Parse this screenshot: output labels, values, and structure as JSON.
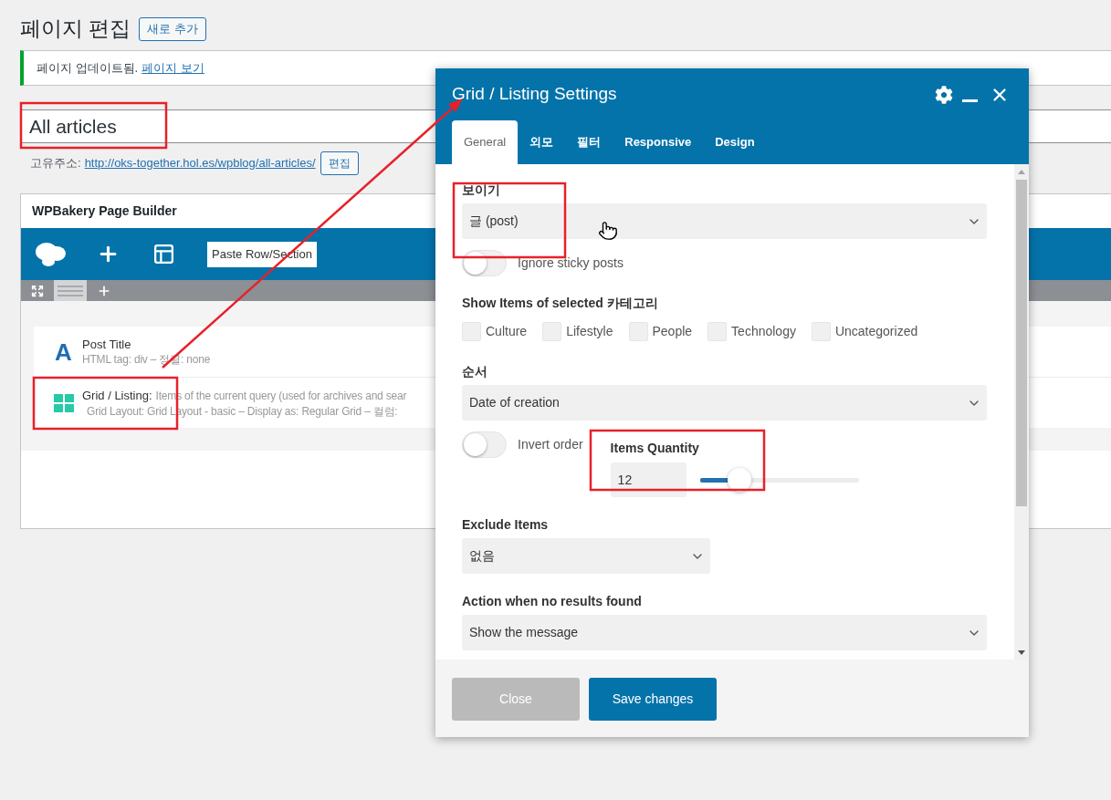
{
  "page": {
    "heading": "페이지 편집",
    "add_new_button": "새로 추가"
  },
  "notice": {
    "message": "페이지 업데이트됨.",
    "link": "페이지 보기"
  },
  "title_field": {
    "value": "All articles"
  },
  "permalink": {
    "label": "고유주소:",
    "url": "http://oks-together.hol.es/wpblog/all-articles/",
    "edit_button": "편집"
  },
  "builder": {
    "title": "WPBakery Page Builder",
    "paste_button": "Paste Row/Section",
    "elements": [
      {
        "kind": "text",
        "icon": "A",
        "name": "Post Title",
        "lines": [
          "HTML tag: div – 정렬: none"
        ]
      },
      {
        "kind": "grid",
        "name": "Grid / Listing:",
        "summary": "Items of the current query (used for archives and sear",
        "lines": [
          "Grid Layout: Grid Layout - basic – Display as: Regular Grid – 컬럼:"
        ]
      }
    ]
  },
  "modal": {
    "title": "Grid / Listing Settings",
    "tabs": [
      {
        "label": "General",
        "selected": true
      },
      {
        "label": "외모",
        "selected": false
      },
      {
        "label": "필터",
        "selected": false
      },
      {
        "label": "Responsive",
        "selected": false
      },
      {
        "label": "Design",
        "selected": false
      }
    ],
    "fields": [
      {
        "kind": "select",
        "label": "보이기",
        "value": "글 (post)"
      },
      {
        "kind": "toggle",
        "label": "Ignore sticky posts",
        "on": false
      },
      {
        "kind": "checkboxes",
        "label": "Show Items of selected 카테고리",
        "options": [
          {
            "label": "Culture",
            "checked": false
          },
          {
            "label": "Lifestyle",
            "checked": false
          },
          {
            "label": "People",
            "checked": false
          },
          {
            "label": "Technology",
            "checked": false
          },
          {
            "label": "Uncategorized",
            "checked": false
          }
        ]
      },
      {
        "kind": "select",
        "label": "순서",
        "value": "Date of creation"
      },
      {
        "kind": "row",
        "items": [
          {
            "kind": "toggle",
            "label": "Invert order",
            "on": false
          },
          {
            "kind": "quantity",
            "label": "Items Quantity",
            "value": "12",
            "level": 0.25
          }
        ]
      },
      {
        "kind": "autocomplete",
        "label": "Exclude Items",
        "value": "없음"
      },
      {
        "kind": "select",
        "label": "Action when no results found",
        "value": "Show the message"
      }
    ],
    "buttons": [
      {
        "kind": "secondary",
        "label": "Close"
      },
      {
        "kind": "primary",
        "label": "Save changes"
      }
    ]
  }
}
